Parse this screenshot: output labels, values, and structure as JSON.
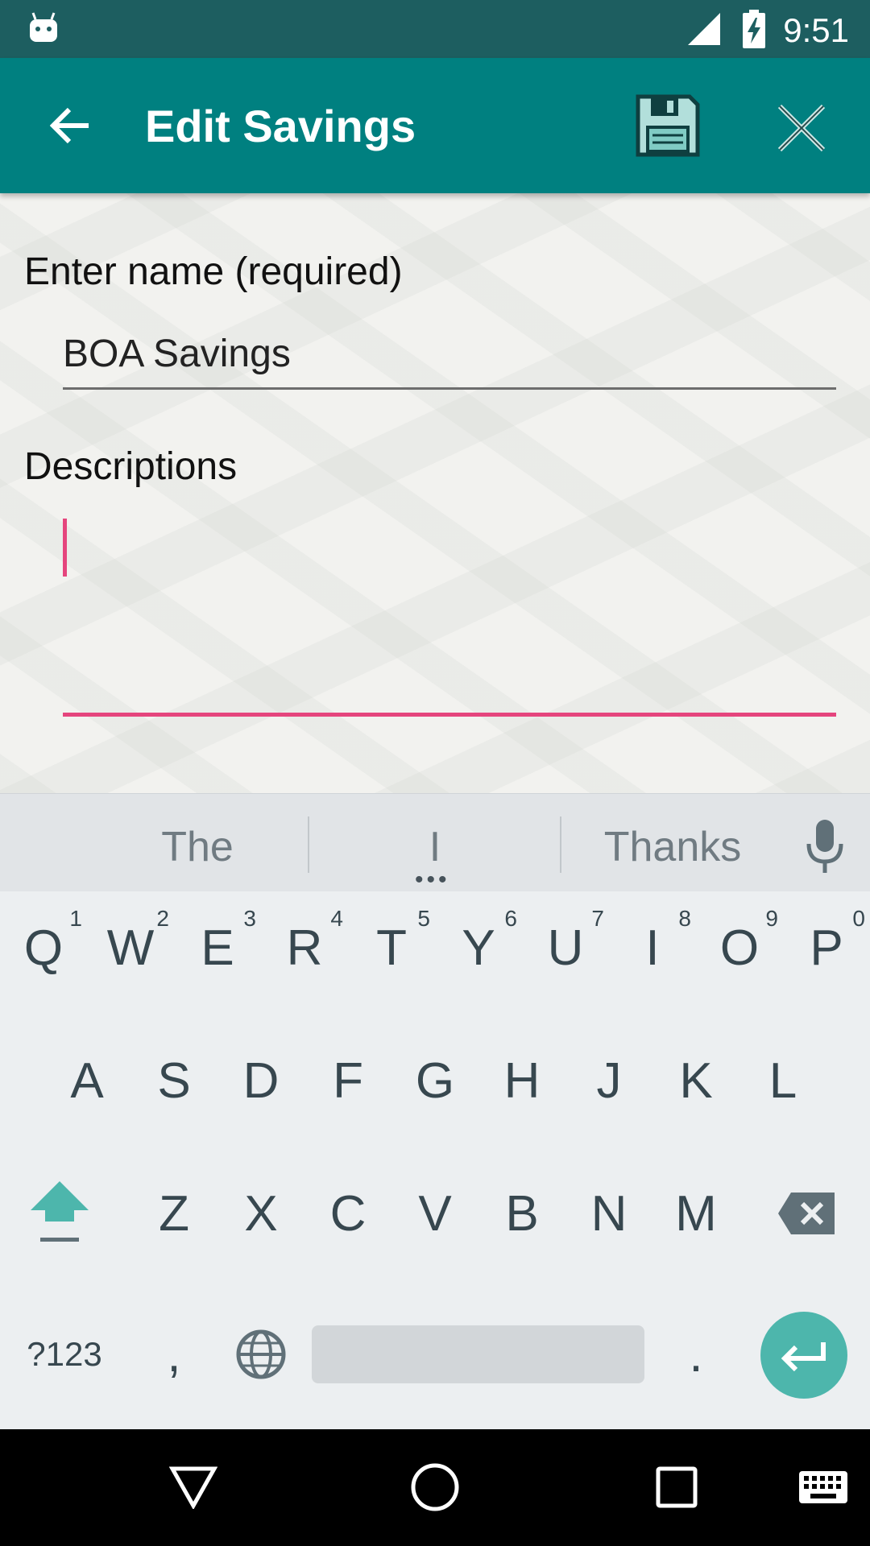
{
  "status_bar": {
    "time": "9:51",
    "icons": [
      "android-icon",
      "signal-icon",
      "battery-charging-icon"
    ]
  },
  "app_bar": {
    "title": "Edit Savings",
    "icons": [
      "back-arrow-icon",
      "save-floppy-icon",
      "close-icon"
    ],
    "color": "#008080"
  },
  "form": {
    "name_label": "Enter name (required)",
    "name_value": "BOA Savings",
    "description_label": "Descriptions",
    "description_value": "",
    "accent_color": "#e5457d"
  },
  "keyboard": {
    "suggestions": [
      "The",
      "I",
      "Thanks"
    ],
    "row1": [
      {
        "key": "Q",
        "hint": "1"
      },
      {
        "key": "W",
        "hint": "2"
      },
      {
        "key": "E",
        "hint": "3"
      },
      {
        "key": "R",
        "hint": "4"
      },
      {
        "key": "T",
        "hint": "5"
      },
      {
        "key": "Y",
        "hint": "6"
      },
      {
        "key": "U",
        "hint": "7"
      },
      {
        "key": "I",
        "hint": "8"
      },
      {
        "key": "O",
        "hint": "9"
      },
      {
        "key": "P",
        "hint": "0"
      }
    ],
    "row2": [
      "A",
      "S",
      "D",
      "F",
      "G",
      "H",
      "J",
      "K",
      "L"
    ],
    "row3": [
      "Z",
      "X",
      "C",
      "V",
      "B",
      "N",
      "M"
    ],
    "symbols_label": "?123",
    "comma": ",",
    "period": ".",
    "icons": [
      "mic-icon",
      "shift-icon",
      "backspace-icon",
      "globe-icon",
      "enter-icon"
    ]
  },
  "nav_bar": {
    "icons": [
      "back-triangle-icon",
      "home-circle-icon",
      "recents-square-icon",
      "keyboard-icon"
    ]
  }
}
